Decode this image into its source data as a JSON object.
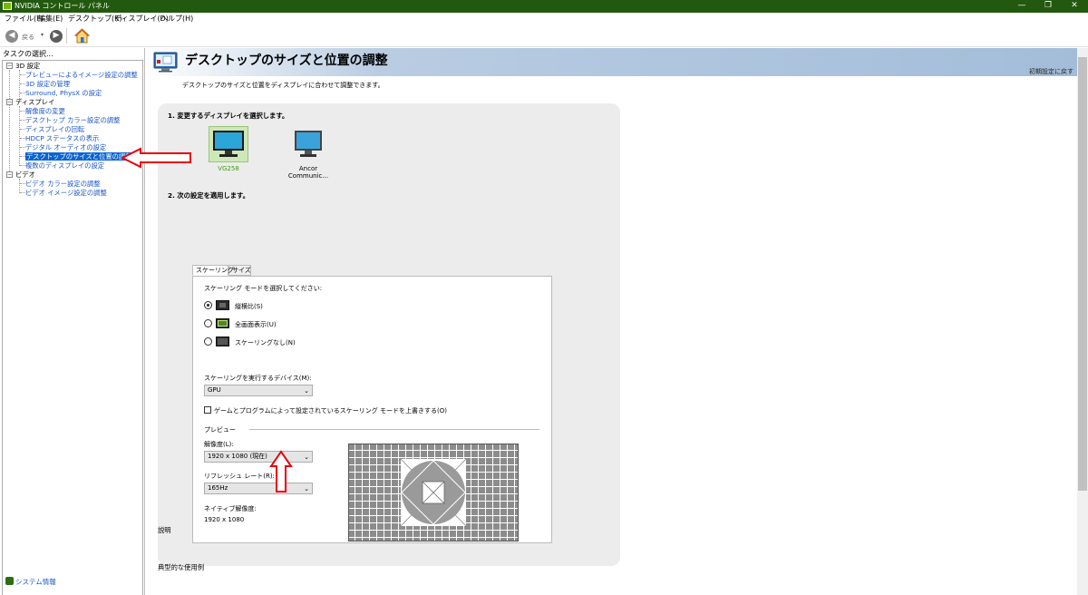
{
  "window": {
    "title": "NVIDIA コントロール パネル",
    "minimize": "—",
    "restore": "❐",
    "close": "✕"
  },
  "menu": [
    "ファイル(F)",
    "編集(E)",
    "デスクトップ(K)",
    "ディスプレイ(D)",
    "ヘルプ(H)"
  ],
  "toolbar": {
    "back_label": "戻る",
    "back_icon": "left-arrow-icon",
    "forward_icon": "right-arrow-icon",
    "home_icon": "home-icon"
  },
  "sidebar": {
    "heading": "タスクの選択...",
    "groups": [
      {
        "label": "3D 設定",
        "items": [
          "プレビューによるイメージ設定の調整",
          "3D 設定の管理",
          "Surround, PhysX の設定"
        ]
      },
      {
        "label": "ディスプレイ",
        "items": [
          "解像度の変更",
          "デスクトップ カラー設定の調整",
          "ディスプレイの回転",
          "HDCP ステータスの表示",
          "デジタル オーディオの設定",
          "デスクトップのサイズと位置の調整",
          "複数のディスプレイの設定"
        ]
      },
      {
        "label": "ビデオ",
        "items": [
          "ビデオ カラー設定の調整",
          "ビデオ イメージ設定の調整"
        ]
      }
    ],
    "selected": "デスクトップのサイズと位置の調整",
    "system_info": "システム情報"
  },
  "page": {
    "title": "デスクトップのサイズと位置の調整",
    "restore_defaults": "初期設定に戻す",
    "subtitle": "デスクトップのサイズと位置をディスプレイに合わせて調整できます。",
    "step1": "1. 変更するディスプレイを選択します。",
    "displays": [
      {
        "name": "VG258",
        "selected": true
      },
      {
        "name": "Ancor Communic...",
        "selected": false
      }
    ],
    "step2": "2. 次の設定を適用します。",
    "tabs": [
      "スケーリング",
      "サイズ"
    ],
    "active_tab": "スケーリング",
    "scaling_prompt": "スケーリング モードを選択してください:",
    "scaling_modes": [
      {
        "label": "縦横比(S)",
        "checked": true
      },
      {
        "label": "全画面表示(U)",
        "checked": false
      },
      {
        "label": "スケーリングなし(N)",
        "checked": false
      }
    ],
    "device_label": "スケーリングを実行するデバイス(M):",
    "device_value": "GPU",
    "override_label": "ゲームとプログラムによって設定されているスケーリング モードを上書きする(O)",
    "override_checked": false,
    "preview_label": "プレビュー",
    "resolution_label": "解像度(L):",
    "resolution_value": "1920 x 1080 (現在)",
    "refresh_label": "リフレッシュ レート(R):",
    "refresh_value": "165Hz",
    "native_label": "ネイティブ解像度:",
    "native_value": "1920 x 1080",
    "description_label": "説明",
    "usage_label": "典型的な使用例"
  },
  "colors": {
    "accent_green": "#76b900",
    "titlebar": "#23590f",
    "link": "#1a55c8",
    "selection": "#0a64d0",
    "annotation_red": "#e8000b"
  }
}
